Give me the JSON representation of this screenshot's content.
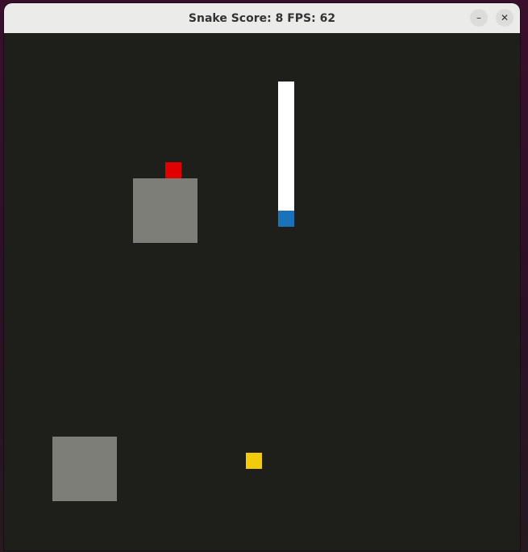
{
  "window": {
    "title": "Snake Score: 8 FPS: 62",
    "minimize_icon": "minimize-icon",
    "close_icon": "close-icon"
  },
  "game": {
    "score": 8,
    "fps": 62,
    "colors": {
      "background": "#1e1e1b",
      "snake_body": "#ffffff",
      "snake_head": "#1a73b8",
      "food_red": "#e00000",
      "food_yellow": "#f2cc0c",
      "obstacle": "#7e7e79"
    }
  }
}
